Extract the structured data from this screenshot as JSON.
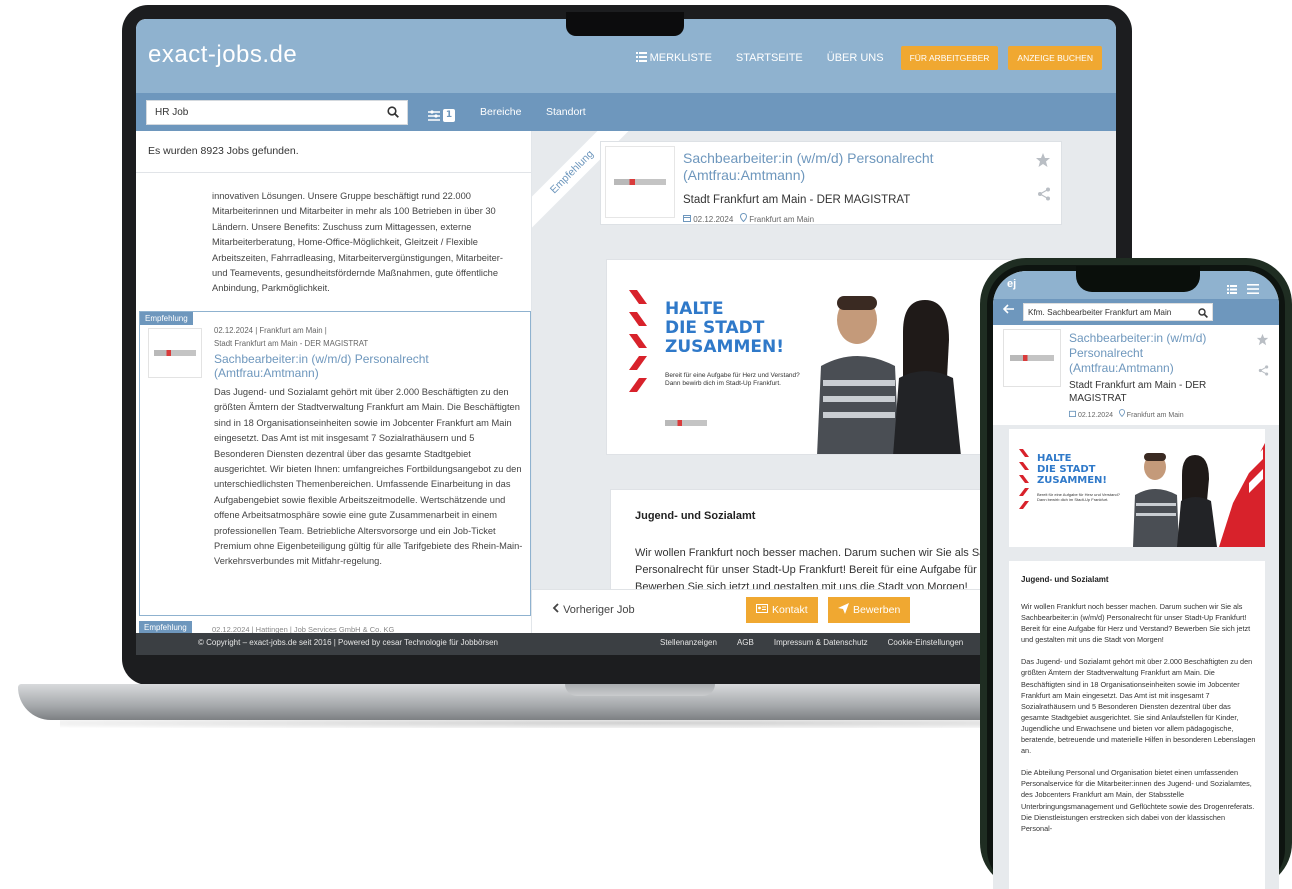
{
  "desktop": {
    "logo": "exact-jobs.de",
    "nav": {
      "merkliste": "MERKLISTE",
      "startseite": "STARTSEITE",
      "ueber_uns": "ÜBER UNS",
      "fuer_arbeitgeber": "FÜR ARBEITGEBER",
      "anzeige_buchen": "ANZEIGE BUCHEN"
    },
    "search": {
      "value": "HR Job"
    },
    "filter_count": "1",
    "sub_links": {
      "bereiche": "Bereiche",
      "standort": "Standort"
    },
    "results_text": "Es wurden 8923 Jobs gefunden.",
    "first_listing_desc": "innovativen Lösungen. Unsere Gruppe beschäftigt rund 22.000 Mitarbeiterinnen und Mitarbeiter in mehr als 100 Betrieben in über 30 Ländern. Unsere Benefits: Zuschuss zum Mittagessen, externe Mitarbeiterberatung, Home-Office-Möglichkeit, Gleitzeit / Flexible Arbeitszeiten, Fahrradleasing, Mitarbeitervergünstigungen, Mitarbeiter- und Teamevents, gesundheitsfördernde Maßnahmen, gute öffentliche Anbindung, Parkmöglichkeit.",
    "listing": {
      "badge": "Empfehlung",
      "meta_line1": "02.12.2024  |  Frankfurt am Main  |",
      "meta_line2": "Stadt Frankfurt am Main - DER MAGISTRAT",
      "title": "Sachbearbeiter:in (w/m/d) Personalrecht (Amtfrau:Amtmann)",
      "description": "Das Jugend- und Sozialamt gehört mit über 2.000 Beschäftigten zu den größten Ämtern der Stadtverwaltung Frankfurt am Main. Die Beschäftigten sind in 18 Organisationseinheiten sowie im Jobcenter Frankfurt am Main eingesetzt. Das Amt ist mit insgesamt 7 Sozialrathäusern und 5 Besonderen Diensten dezentral über das gesamte Stadtgebiet ausgerichtet. Wir bieten Ihnen: umfangreiches Fortbildungsangebot zu den unterschiedlichsten Themenbereichen. Umfassende Einarbeitung in das Aufgabengebiet sowie flexible Arbeitszeitmodelle. Wertschätzende und offene Arbeitsatmosphäre sowie eine gute Zusammenarbeit in einem professionellen Team. Betriebliche Altersvorsorge und ein Job-Ticket Premium ohne Eigenbeteiligung gültig für alle Tarifgebiete des Rhein-Main-Verkehrsverbundes mit Mitfahr-regelung."
    },
    "listing2": {
      "badge": "Empfehlung",
      "meta": "02.12.2024  |  Hattingen  |  Job Services GmbH & Co. KG"
    },
    "detail": {
      "ribbon": "Empfehlung",
      "title": "Sachbearbeiter:in (w/m/d) Personalrecht (Amtfrau:Amtmann)",
      "company": "Stadt Frankfurt am Main - DER MAGISTRAT",
      "date": "02.12.2024",
      "location": "Frankfurt am Main",
      "banner_line1": "HALTE",
      "banner_line2": "DIE STADT",
      "banner_line3": "ZUSAMMEN!",
      "banner_small": "Bereit für eine Aufgabe für Herz und Verstand? Dann bewirb dich im Stadt-Up Frankfurt.",
      "content_heading": "Jugend- und Sozialamt",
      "content_body": "Wir wollen Frankfurt noch besser machen. Darum suchen wir Sie als Sachbearbeiter:in (w/m/d) Personalrecht für unser Stadt-Up Frankfurt! Bereit für eine Aufgabe für Herz und Verstand? Bewerben Sie sich jetzt und gestalten mit uns die Stadt von Morgen!"
    },
    "actions": {
      "prev": "Vorheriger Job",
      "kontakt": "Kontakt",
      "bewerben": "Bewerben"
    },
    "footer": {
      "copyright": "© Copyright – exact-jobs.de seit 2016 | Powered by cesar Technologie für Jobbörsen",
      "stellenanzeigen": "Stellenanzeigen",
      "agb": "AGB",
      "impressum": "Impressum & Datenschutz",
      "cookie": "Cookie-Einstellungen"
    }
  },
  "mobile": {
    "logo": "ej",
    "search": {
      "value": "Kfm. Sachbearbeiter Frankfurt am Main"
    },
    "title": "Sachbearbeiter:in (w/m/d) Personalrecht (Amtfrau:Amtmann)",
    "company": "Stadt Frankfurt am Main - DER MAGISTRAT",
    "date": "02.12.2024",
    "location": "Frankfurt am Main",
    "banner_line1": "HALTE",
    "banner_line2": "DIE STADT",
    "banner_line3": "ZUSAMMEN!",
    "banner_small": "Bereit für eine Aufgabe für Herz und Verstand? Dann bewirb dich im Stadt-Up Frankfurt.",
    "content_heading": "Jugend- und Sozialamt",
    "para1": "Wir wollen Frankfurt noch besser machen. Darum suchen wir Sie als Sachbearbeiter:in (w/m/d) Personalrecht für unser Stadt-Up Frankfurt! Bereit für eine Aufgabe für Herz und Verstand? Bewerben Sie sich jetzt und gestalten mit uns die Stadt von Morgen!",
    "para2": "Das Jugend- und Sozialamt gehört mit über 2.000 Beschäftigten zu den größten Ämtern der Stadtverwaltung Frankfurt am Main. Die Beschäftigten sind in 18 Organisationseinheiten sowie im Jobcenter Frankfurt am Main eingesetzt. Das Amt ist mit insgesamt 7 Sozialrathäusern und 5 Besonderen Diensten dezentral über das gesamte Stadtgebiet ausgerichtet. Sie sind Anlaufstellen für Kinder, Jugendliche und Erwachsene und bieten vor allem pädagogische, beratende, betreuende und materielle Hilfen in besonderen Lebenslagen an.",
    "para3": "Die Abteilung Personal und Organisation bietet einen umfassenden Personalservice für die Mitarbeiter:innen des Jugend- und Sozialamtes, des Jobcenters Frankfurt am Main, der Stabsstelle Unterbringungsmanagement und Geflüchtete sowie des Drogenreferats. Die Dienstleistungen erstrecken sich dabei von der klassischen Personal-"
  },
  "colors": {
    "header": "#8fb2cf",
    "subbar": "#6e97bd",
    "accent_orange": "#f0a831",
    "link_blue": "#6e97bd",
    "banner_blue": "#2f79c9",
    "banner_red": "#d8222b"
  },
  "icons": [
    "list-icon",
    "search-icon",
    "filter-icon",
    "star-icon",
    "share-icon",
    "calendar-icon",
    "location-pin-icon",
    "chevron-left-icon",
    "contact-card-icon",
    "send-icon",
    "menu-icon",
    "back-arrow-icon"
  ]
}
